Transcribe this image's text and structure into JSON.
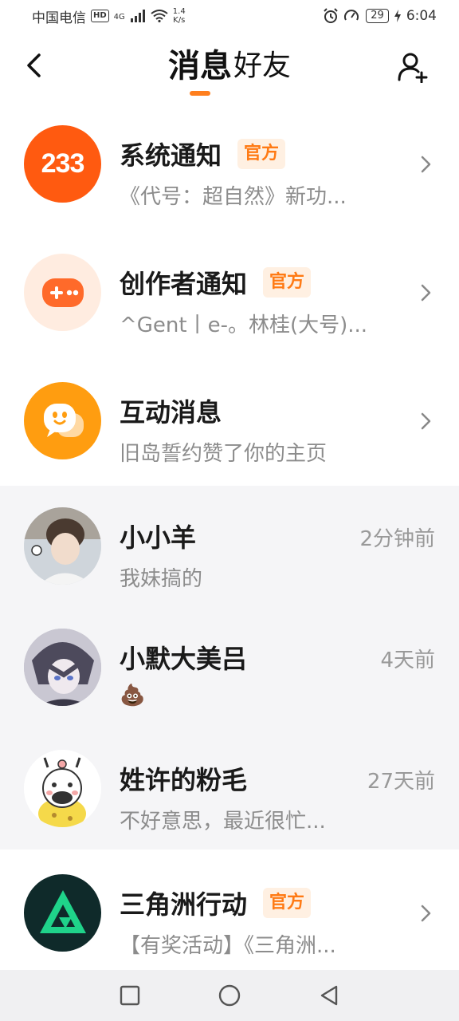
{
  "status_bar": {
    "carrier": "中国电信",
    "hd": "HD",
    "network": "4G",
    "speed_value": "1.4",
    "speed_unit": "K/s",
    "battery": "29",
    "time": "6:04"
  },
  "header": {
    "tabs": [
      {
        "label": "消息",
        "active": true
      },
      {
        "label": "好友",
        "active": false
      }
    ],
    "accent_color": "#ff7f1e"
  },
  "notifications": [
    {
      "title": "系统通知",
      "badge": "官方",
      "subtitle": "《代号：超自然》新功...",
      "avatar_text": "233",
      "avatar_color": "#ff5a10"
    },
    {
      "title": "创作者通知",
      "badge": "官方",
      "subtitle": "^Gent丨e-。林桂(大号)...",
      "avatar_color": "#ffece0"
    },
    {
      "title": "互动消息",
      "badge": "",
      "subtitle": "旧岛誓约赞了你的主页",
      "avatar_color": "#ff9d10"
    }
  ],
  "friends": [
    {
      "name": "小小羊",
      "time": "2分钟前",
      "message": "我妹搞的"
    },
    {
      "name": "小默大美吕",
      "time": "4天前",
      "message": "💩"
    },
    {
      "name": "姓许的粉毛",
      "time": "27天前",
      "message": "不好意思，最近很忙..."
    }
  ],
  "official_game": {
    "title": "三角洲行动",
    "badge": "官方",
    "subtitle": "【有奖活动】《三角洲..."
  }
}
